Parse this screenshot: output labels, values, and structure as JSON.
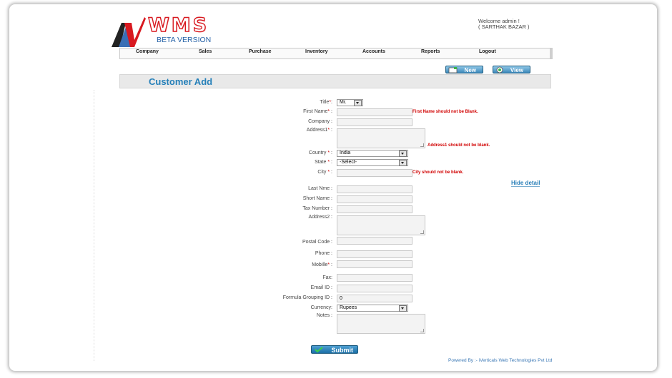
{
  "brand": {
    "logo_text": "WMS",
    "subtitle": "BETA VERSION"
  },
  "welcome": {
    "line1": "Welcome admin !",
    "line2": "( SARTHAK BAZAR )"
  },
  "nav": [
    "Company",
    "Sales",
    "Purchase",
    "Inventory",
    "Accounts",
    "Reports",
    "Logout"
  ],
  "toolbar": {
    "new_label": "New",
    "view_label": "View"
  },
  "page_title": "Customer Add",
  "form": {
    "title_label": "Title",
    "title_value": "Mr.",
    "first_name_label": "First Name",
    "first_name_error": "First Name should not be Blank.",
    "company_label": "Company :",
    "address1_label": "Address1",
    "address1_error": "Address1 should not be blank.",
    "country_label": "Country",
    "country_value": "India",
    "state_label": "State",
    "state_value": "-Select-",
    "city_label": "City",
    "city_error": "City should not be blank.",
    "hide_detail": "Hide detail",
    "last_name_label": "Last Nme :",
    "short_name_label": "Short Name :",
    "tax_number_label": "Tax Number :",
    "address2_label": "Address2 :",
    "postal_code_label": "Postal Code :",
    "phone_label": "Phone :",
    "mobile_label": "Mobille",
    "fax_label": "Fax:",
    "email_label": "Email ID :",
    "formula_label": "Formula Grouping ID :",
    "formula_value": "0",
    "currency_label": "Currency:",
    "currency_value": "Rupees",
    "notes_label": "Notes :",
    "submit_label": "Submit"
  },
  "footer": "Powered By :- iVerticals Web Technologies Pvt Ltd",
  "colors": {
    "accent": "#2680b9",
    "error": "#d10000",
    "logo": "#d81920"
  }
}
